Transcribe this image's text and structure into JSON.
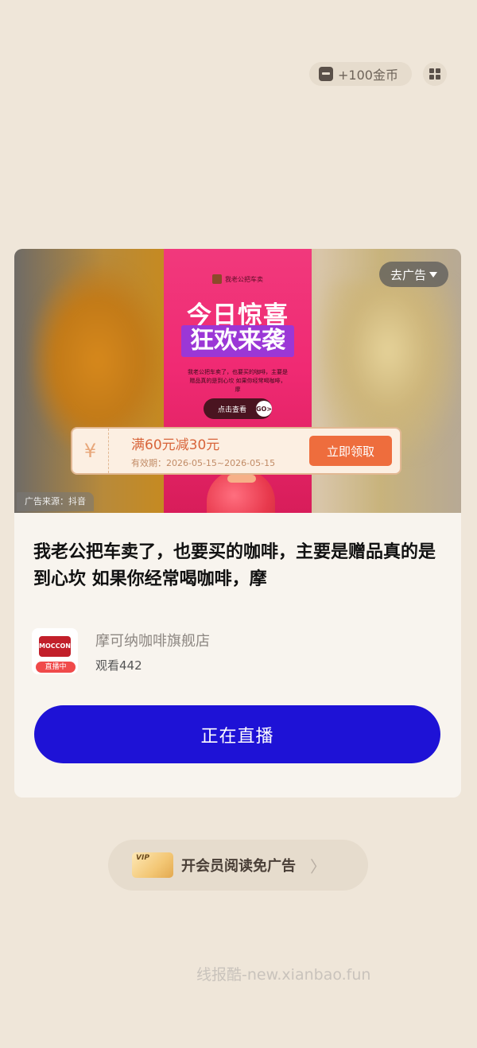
{
  "top": {
    "coin_label": "+100金币",
    "wallet_icon": "wallet-icon",
    "menu_icon": "grid-icon"
  },
  "ad": {
    "poster": {
      "brand": "我老公把车卖",
      "headline": "今日惊喜",
      "subheadline": "狂欢来袭",
      "desc": "我老公把车卖了，也要买的咖啡，主要是赠品真的是到心坎 如果你经常喝咖啡，摩",
      "cta": "点击查看",
      "cta_go": "GO>"
    },
    "go_ad_label": "去广告",
    "coupon": {
      "currency": "¥",
      "title": "满60元减30元",
      "validity": "有效期：2026-05-15~2026-05-15",
      "claim": "立即领取"
    },
    "source": "广告来源：抖音",
    "text": "我老公把车卖了，也要买的咖啡，主要是赠品真的是到心坎 如果你经常喝咖啡，摩",
    "shop": {
      "logo_text": "MOCCONA",
      "live_badge": "直播中",
      "name": "摩可纳咖啡旗舰店",
      "views": "观看442"
    },
    "live_button": "正在直播"
  },
  "vip": {
    "badge": "VIP",
    "text": "开会员阅读免广告",
    "arrow": "〉"
  },
  "watermark": "线报酷-new.xianbao.fun",
  "colors": {
    "background": "#efe6d9",
    "live_button": "#1e12d6",
    "claim_button": "#ee6d3d",
    "poster": "#f02a73"
  }
}
